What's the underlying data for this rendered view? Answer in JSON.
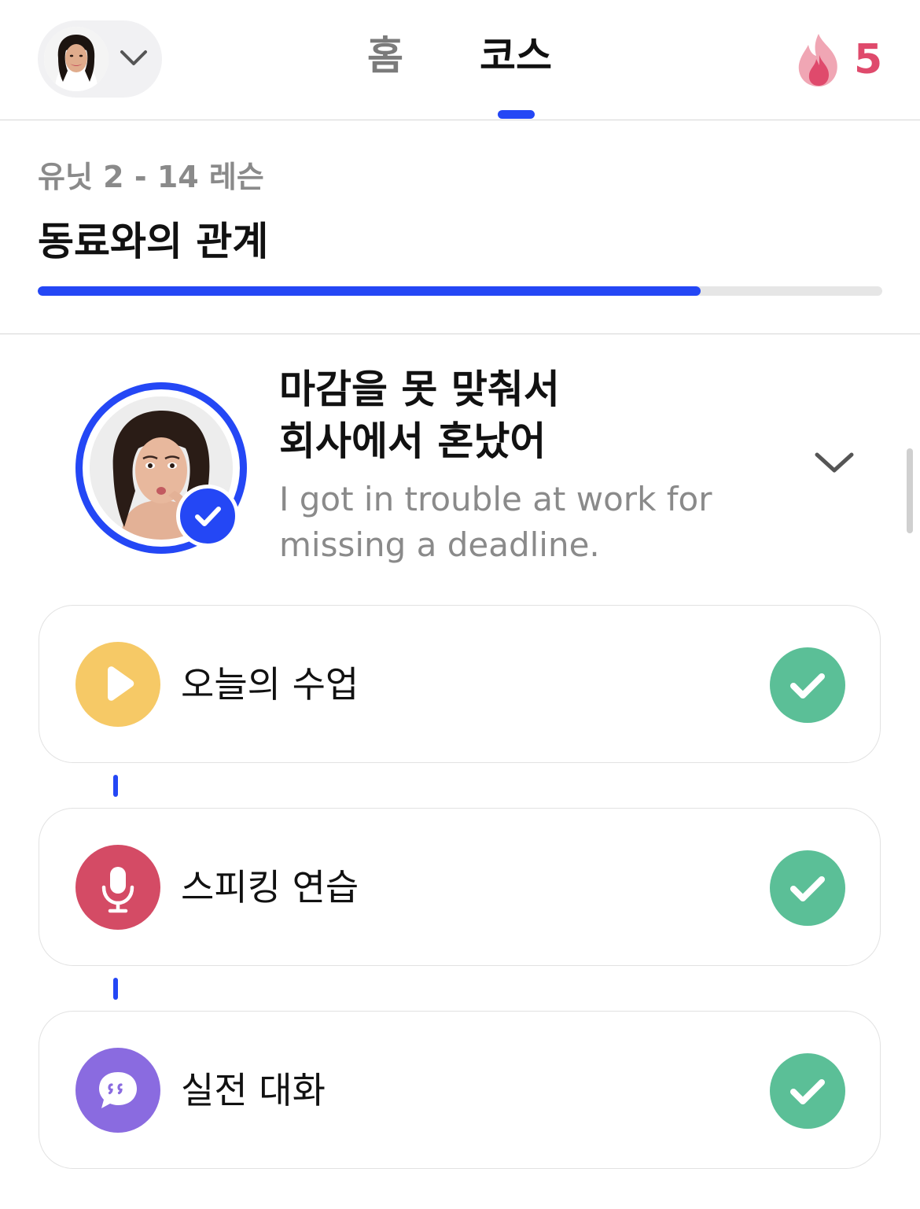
{
  "header": {
    "tabs": [
      {
        "label": "홈",
        "active": false
      },
      {
        "label": "코스",
        "active": true
      }
    ],
    "streak_count": "5",
    "accent_color": "#2447f5",
    "streak_color": "#df4a6c"
  },
  "unit": {
    "subtitle": "유닛 2 - 14 레슨",
    "title": "동료와의 관계",
    "progress_fraction": 0.785
  },
  "lesson": {
    "title_line1": "마감을 못 맞춰서",
    "title_line2": "회사에서 혼났어",
    "translation_line1": "I got in trouble at work for",
    "translation_line2": "missing a deadline.",
    "completed": true
  },
  "activities": [
    {
      "label": "오늘의 수업",
      "icon": "play-icon",
      "icon_color": "#f6c966",
      "completed": true
    },
    {
      "label": "스피킹 연습",
      "icon": "microphone-icon",
      "icon_color": "#d44b65",
      "completed": true
    },
    {
      "label": "실전 대화",
      "icon": "chat-bubble-icon",
      "icon_color": "#8a6be0",
      "completed": true
    }
  ],
  "complete_color": "#5bbf97"
}
